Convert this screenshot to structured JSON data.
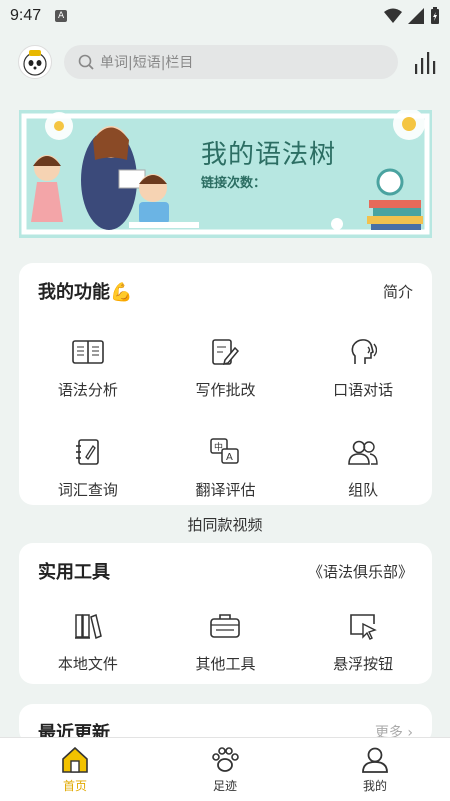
{
  "status_bar": {
    "time": "9:47",
    "badge": "A"
  },
  "search": {
    "placeholder": "单词|短语|栏目"
  },
  "banner": {
    "title": "我的语法树",
    "subtitle": "链接次数："
  },
  "functions": {
    "title": "我的功能💪",
    "link": "简介",
    "items": [
      {
        "label": "语法分析",
        "icon": "book-icon"
      },
      {
        "label": "写作批改",
        "icon": "edit-document-icon"
      },
      {
        "label": "口语对话",
        "icon": "voice-head-icon"
      },
      {
        "label": "词汇查询",
        "icon": "notebook-icon"
      },
      {
        "label": "翻译评估",
        "icon": "translate-icon"
      },
      {
        "label": "组队",
        "icon": "team-icon"
      }
    ]
  },
  "video_link": "拍同款视频",
  "tools": {
    "title": "实用工具",
    "link": "《语法俱乐部》",
    "items": [
      {
        "label": "本地文件",
        "icon": "library-icon"
      },
      {
        "label": "其他工具",
        "icon": "toolbox-icon"
      },
      {
        "label": "悬浮按钮",
        "icon": "cursor-window-icon"
      }
    ]
  },
  "recent": {
    "title": "最近更新",
    "more": "更多 ›"
  },
  "bottom_nav": [
    {
      "label": "首页",
      "icon": "home-icon",
      "active": true
    },
    {
      "label": "足迹",
      "icon": "paw-icon",
      "active": false
    },
    {
      "label": "我的",
      "icon": "user-icon",
      "active": false
    }
  ],
  "colors": {
    "accent": "#e0a800",
    "banner_bg": "#b7e7e1",
    "banner_text": "#2c6e63",
    "page_bg": "#eef3f1"
  }
}
